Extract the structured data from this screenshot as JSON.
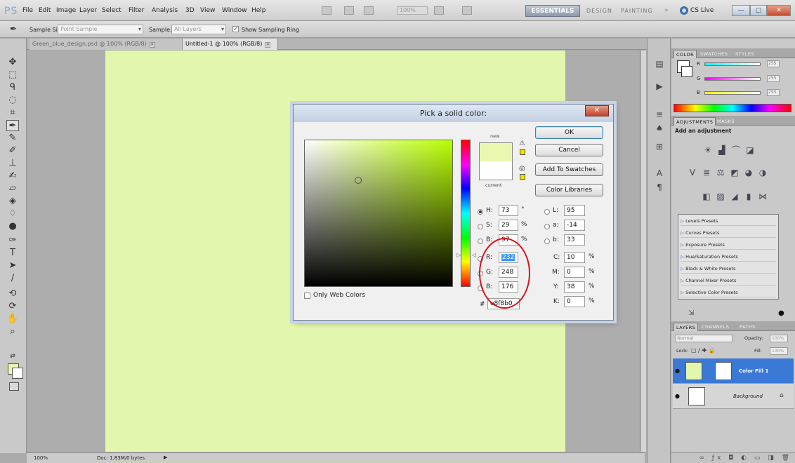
{
  "app": {
    "logo": "PS",
    "menu": [
      "File",
      "Edit",
      "Image",
      "Layer",
      "Select",
      "Filter",
      "Analysis",
      "3D",
      "View",
      "Window",
      "Help"
    ],
    "zoom_dropdown": "100%",
    "workspaces": {
      "active": "ESSENTIALS",
      "design": "DESIGN",
      "painting": "PAINTING",
      "more": "»"
    },
    "cslive": "CS Live",
    "window_buttons": {
      "minimize": "—",
      "restore": "▢",
      "close": "✕"
    }
  },
  "options_bar": {
    "sample_size_label": "Sample Size:",
    "sample_size_value": "Point Sample",
    "sample_label": "Sample:",
    "sample_value": "All Layers",
    "show_ring_label": "Show Sampling Ring"
  },
  "tabs": [
    {
      "label": "Green_blue_design.psd @ 100% (RGB/8)"
    },
    {
      "label": "Untitled-1 @ 100% (RGB/8)"
    }
  ],
  "status": {
    "zoom": "100%",
    "doc": "Doc: 1.83M/0 bytes"
  },
  "dialog": {
    "title": "Pick a solid color:",
    "close": "✕",
    "new_label": "new",
    "current_label": "current",
    "buttons": {
      "ok": "OK",
      "cancel": "Cancel",
      "add_swatches": "Add To Swatches",
      "color_libraries": "Color Libraries"
    },
    "hsb": {
      "h": "73",
      "s": "29",
      "b": "97",
      "h_unit": "°",
      "s_unit": "%",
      "b_unit": "%"
    },
    "rgb": {
      "r": "232",
      "g": "248",
      "b": "176"
    },
    "lab": {
      "l": "95",
      "a": "-14",
      "b": "33"
    },
    "cmyk": {
      "c": "10",
      "m": "0",
      "y": "38",
      "k": "0"
    },
    "hex": "e8f8b0",
    "labels": {
      "h": "H:",
      "s": "S:",
      "b": "B:",
      "r": "R:",
      "g": "G:",
      "bb": "B:",
      "l": "L:",
      "a": "a:",
      "lb": "b:",
      "c": "C:",
      "m": "M:",
      "y": "Y:",
      "k": "K:",
      "hash": "#",
      "pct": "%"
    },
    "only_web_colors": "Only Web Colors"
  },
  "panels": {
    "color_tabs": [
      "COLOR",
      "SWATCHES",
      "STYLES"
    ],
    "color_sliders": {
      "r": "R",
      "g": "G",
      "b": "B",
      "r_val": "255",
      "g_val": "255",
      "b_val": "255"
    },
    "adjust_tabs": [
      "ADJUSTMENTS",
      "MASKS"
    ],
    "add_adjustment": "Add an adjustment",
    "presets": [
      "Levels Presets",
      "Curves Presets",
      "Exposure Presets",
      "Hue/Saturation Presets",
      "Black & White Presets",
      "Channel Mixer Presets",
      "Selective Color Presets"
    ],
    "layers_tabs": [
      "LAYERS",
      "CHANNELS",
      "PATHS"
    ],
    "blend_mode": "Normal",
    "opacity_label": "Opacity:",
    "opacity": "100%",
    "lock_label": "Lock:",
    "fill_label": "Fill:",
    "fill": "100%",
    "layers": [
      {
        "name": "Color Fill 1"
      },
      {
        "name": "Background"
      }
    ]
  },
  "colors": {
    "fill": "#e2f7ad",
    "new_color": "#e8f8b0",
    "accent": "#3a79d6",
    "annotation": "#e0101a"
  }
}
